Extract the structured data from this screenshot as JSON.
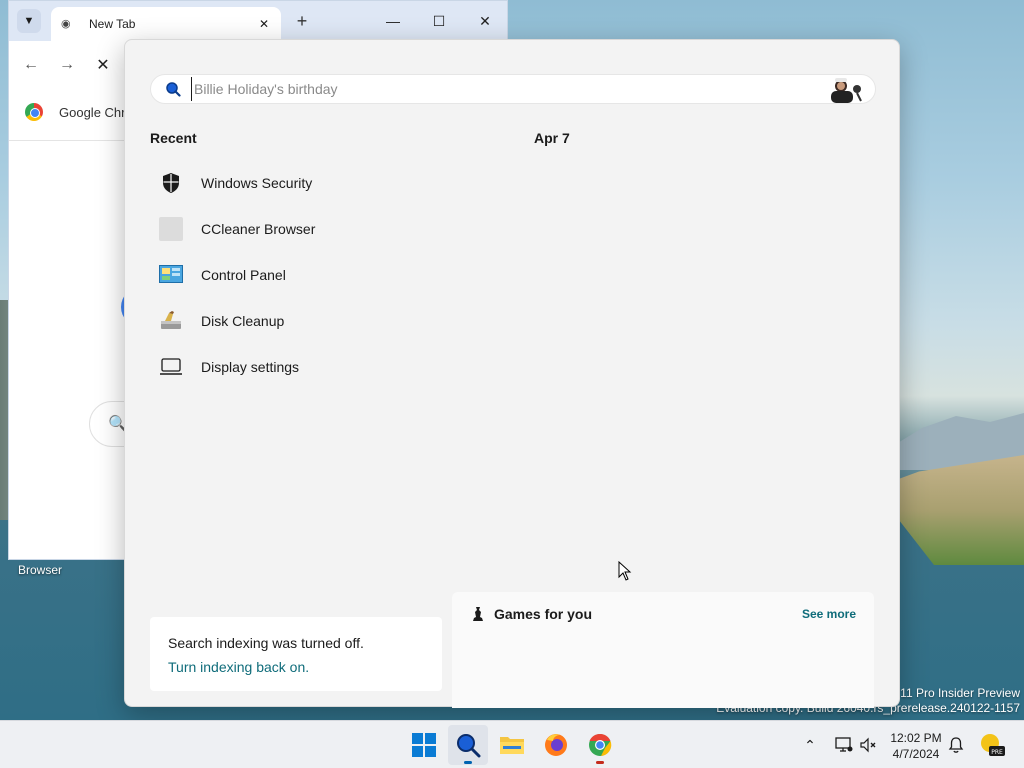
{
  "desktop": {
    "icon_label": "Browser",
    "watermark_line1": "s 11 Pro Insider Preview",
    "watermark_line2": "Evaluation copy. Build 26040.rs_prerelease.240122-1157"
  },
  "chrome": {
    "tab_title": "New Tab",
    "bookmark_label": "Google Chr"
  },
  "search": {
    "placeholder": "Billie Holiday's birthday",
    "recent_title": "Recent",
    "date_title": "Apr 7",
    "recent_items": [
      {
        "label": "Windows Security",
        "icon": "shield-icon"
      },
      {
        "label": "CCleaner Browser",
        "icon": "ccleaner-icon"
      },
      {
        "label": "Control Panel",
        "icon": "control-panel-icon"
      },
      {
        "label": "Disk Cleanup",
        "icon": "disk-cleanup-icon"
      },
      {
        "label": "Display settings",
        "icon": "display-icon"
      }
    ],
    "indexing": {
      "message": "Search indexing was turned off.",
      "link": "Turn indexing back on."
    },
    "games": {
      "title": "Games for you",
      "see_more": "See more"
    }
  },
  "taskbar": {
    "time": "12:02 PM",
    "date": "4/7/2024",
    "apps": [
      "start-icon",
      "search-icon",
      "file-explorer-icon",
      "firefox-icon",
      "chrome-icon"
    ]
  },
  "colors": {
    "accent": "#0063b1",
    "link": "#0f6c7a",
    "panel_bg": "#f3f3f3"
  }
}
